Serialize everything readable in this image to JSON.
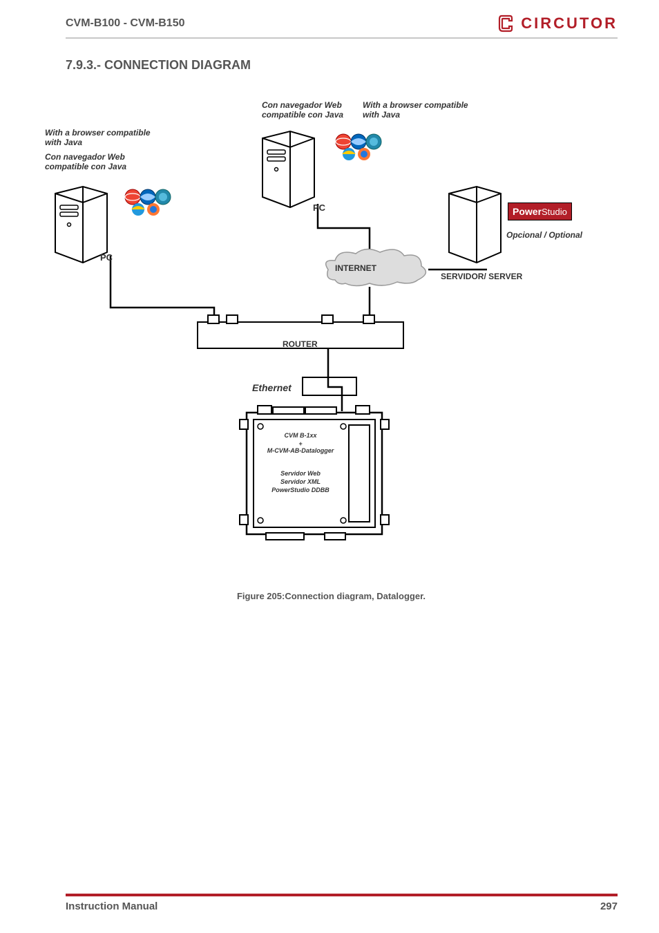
{
  "header": {
    "title": "CVM-B100 - CVM-B150",
    "brand": "CIRCUTOR"
  },
  "section": {
    "number_title": "7.9.3.- CONNECTION DIAGRAM"
  },
  "diagram": {
    "annot_left_en": "With a browser compatible with Java",
    "annot_left_es": "Con navegador Web compatible con Java",
    "annot_top_es": "Con navegador Web compatible con Java",
    "annot_top_en": "With a browser compatible with Java",
    "pc1": "PC",
    "pc2": "PC",
    "internet": "INTERNET",
    "server": "SERVIDOR/ SERVER",
    "powerstudio": "Power",
    "powerstudio2": "Studio",
    "optional": "Opcional / Optional",
    "router": "ROUTER",
    "ethernet": "Ethernet",
    "device_line1": "CVM B-1xx",
    "device_line2": "+",
    "device_line3": "M-CVM-AB-Datalogger",
    "device_line4": "Servidor Web",
    "device_line5": "Servidor XML",
    "device_line6": "PowerStudio DDBB"
  },
  "figure_caption": "Figure 205:Connection diagram, Datalogger.",
  "footer": {
    "left": "Instruction Manual",
    "right": "297"
  }
}
